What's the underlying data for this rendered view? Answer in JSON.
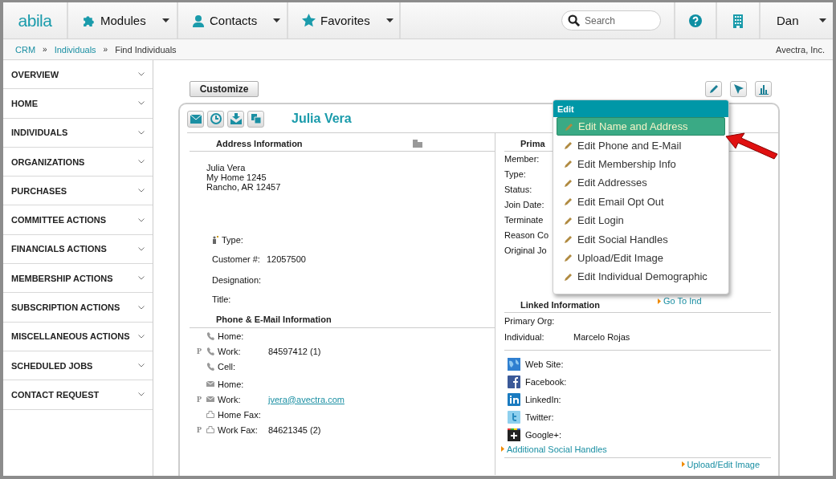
{
  "header": {
    "logo": "abila",
    "nav": [
      {
        "label": "Modules",
        "kind": "puzzle"
      },
      {
        "label": "Contacts",
        "kind": "person"
      },
      {
        "label": "Favorites",
        "kind": "star"
      }
    ],
    "search": {
      "placeholder": "Search"
    },
    "user": "Dan"
  },
  "breadcrumb": {
    "items": [
      "CRM",
      "Individuals",
      "Find Individuals"
    ],
    "separator": "»",
    "organization": "Avectra, Inc."
  },
  "sidebar": {
    "items": [
      {
        "label": "OVERVIEW"
      },
      {
        "label": "HOME"
      },
      {
        "label": "INDIVIDUALS"
      },
      {
        "label": "ORGANIZATIONS"
      },
      {
        "label": "PURCHASES"
      },
      {
        "label": "COMMITTEE ACTIONS"
      },
      {
        "label": "FINANCIALS ACTIONS"
      },
      {
        "label": "MEMBERSHIP ACTIONS"
      },
      {
        "label": "SUBSCRIPTION ACTIONS"
      },
      {
        "label": "MISCELLANEOUS ACTIONS"
      },
      {
        "label": "SCHEDULED JOBS"
      },
      {
        "label": "CONTACT REQUEST"
      }
    ]
  },
  "toolbar": {
    "customize": "Customize"
  },
  "record": {
    "name": "Julia Vera",
    "address_section": {
      "title": "Address Information",
      "lines": [
        "Julia Vera",
        "My Home 1245",
        "Rancho, AR 12457"
      ]
    },
    "fields": [
      {
        "label": "Type:",
        "kind": "type"
      },
      {
        "label": "Customer #:",
        "value": "12057500"
      },
      {
        "label": "Designation:"
      },
      {
        "label": "Title:"
      }
    ],
    "phone_section": {
      "title": "Phone & E-Mail Information",
      "rows": [
        {
          "kind": "phone",
          "label": "Home:"
        },
        {
          "kind": "phone",
          "label": "Work:",
          "value": "84597412 (1)",
          "marker": "P"
        },
        {
          "kind": "phone",
          "label": "Cell:"
        },
        {
          "kind": "email",
          "label": "Home:"
        },
        {
          "kind": "email",
          "label": "Work:",
          "value": "jvera@avectra.com",
          "marker": "P"
        },
        {
          "kind": "fax",
          "label": "Home Fax:"
        },
        {
          "kind": "fax",
          "label": "Work Fax:",
          "value": "84621345 (2)",
          "marker": "P"
        }
      ]
    },
    "primary_section": {
      "title": "Prima",
      "labels": [
        "Member:",
        "Type:",
        "Status:",
        "Join Date:",
        "Terminate",
        "Reason Co",
        "Original Jo"
      ]
    },
    "linked_section": {
      "title": "Linked Information",
      "link": "Go To Ind",
      "fields": [
        {
          "label": "Primary Org:"
        },
        {
          "label": "Individual:",
          "value": "Marcelo Rojas"
        }
      ]
    },
    "social": {
      "items": [
        {
          "kind": "web",
          "label": "Web Site:"
        },
        {
          "kind": "facebook",
          "label": "Facebook:"
        },
        {
          "kind": "linkedin",
          "label": "LinkedIn:"
        },
        {
          "kind": "twitter",
          "label": "Twitter:"
        },
        {
          "kind": "google",
          "label": "Google+:"
        }
      ],
      "more": "Additional Social Handles",
      "image_link": "Upload/Edit Image"
    }
  },
  "edit_menu": {
    "title": "Edit",
    "items": [
      {
        "label": "Edit Name and Address",
        "selected": true
      },
      {
        "label": "Edit Phone and E-Mail",
        "selected": false
      },
      {
        "label": "Edit Membership Info",
        "selected": false
      },
      {
        "label": "Edit Addresses",
        "selected": false
      },
      {
        "label": "Edit Email Opt Out",
        "selected": false
      },
      {
        "label": "Edit Login",
        "selected": false
      },
      {
        "label": "Edit Social Handles",
        "selected": false
      },
      {
        "label": "Upload/Edit Image",
        "selected": false
      },
      {
        "label": "Edit Individual Demographic",
        "selected": false
      }
    ]
  }
}
